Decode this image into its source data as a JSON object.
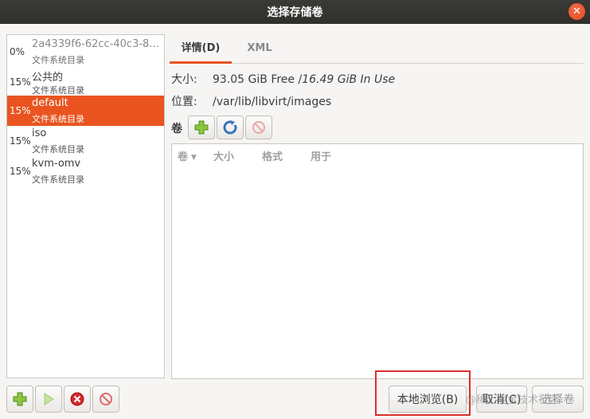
{
  "window": {
    "title": "选择存储卷"
  },
  "pools": [
    {
      "percent": "0%",
      "name": "2a4339f6-62cc-40c3-8...",
      "type": "文件系统目录"
    },
    {
      "percent": "15%",
      "name": "公共的",
      "type": "文件系统目录"
    },
    {
      "percent": "15%",
      "name": "default",
      "type": "文件系统目录"
    },
    {
      "percent": "15%",
      "name": "iso",
      "type": "文件系统目录"
    },
    {
      "percent": "15%",
      "name": "kvm-omv",
      "type": "文件系统目录"
    }
  ],
  "selected_pool": "default",
  "tabs": {
    "details": "详情(D)",
    "xml": "XML"
  },
  "details": {
    "size_label": "大小:",
    "size_free": "93.05 GiB Free / ",
    "size_used": "16.49 GiB In Use",
    "location_label": "位置:",
    "location_value": "/var/lib/libvirt/images"
  },
  "volumes": {
    "label": "卷",
    "columns": [
      "卷",
      "大小",
      "格式",
      "用于"
    ]
  },
  "buttons": {
    "browse_local": "本地浏览(B)",
    "cancel": "取消(C)",
    "choose": "选择卷"
  },
  "watermark": "@稀土掘金技术社区",
  "colors": {
    "accent": "#e95420",
    "highlight": "#d9302c"
  }
}
